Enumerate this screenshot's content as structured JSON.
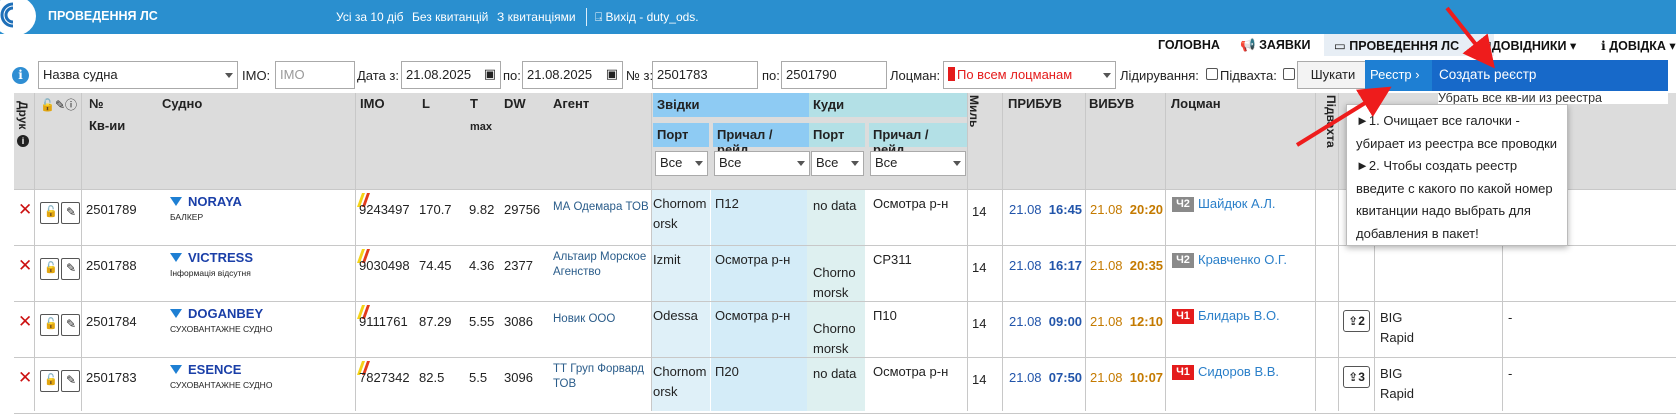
{
  "topbar": {
    "app_title": "ПРОВЕДЕННЯ ЛС",
    "links": [
      "Усі за 10 діб",
      "Без квитанцій",
      "З квитанціями"
    ],
    "exit_label": "Вихід - duty_ods."
  },
  "nav": {
    "home": "ГОЛОВНА",
    "requests": "ЗАЯВКИ",
    "pilotage": "ПРОВЕДЕННЯ ЛС",
    "references": "ДОВІДНИКИ",
    "help": "ДОВІДКА"
  },
  "filters": {
    "ship_select": "Назва судна",
    "imo_label": "IMO:",
    "imo_placeholder": "IMO",
    "date_from_label": "Дата з:",
    "date_from": "21.08.2025",
    "date_to_label": "по:",
    "date_to": "21.08.2025",
    "num_from_label": "№ з:",
    "num_from": "2501783",
    "num_to_label": "по:",
    "num_to": "2501790",
    "pilot_label": "Лоцман:",
    "pilot_select": "По всем лоцманам",
    "leading_label": "Лідирування:",
    "towage_label": "Підвахта:",
    "search_button": "Шукати",
    "registry_button": "Реєстр ›",
    "create_registry": "Создать реєстр",
    "remove_all_hint": "Убрать все кв-ии из реестра"
  },
  "popup": {
    "line1": "►1. Очищает все галочки - убирает из реестра все проводки",
    "line2": "►2. Чтобы создать реестр введите с какого по какой номер квитанции надо выбрать для добавления в пакет!"
  },
  "headers": {
    "print": "Друк",
    "num": "№",
    "num2": "Кв-ии",
    "ship": "Судно",
    "imo": "IMO",
    "l": "L",
    "t": "T",
    "tmax": "max",
    "dw": "DW",
    "agent": "Агент",
    "from": "Звідки",
    "to": "Куди",
    "port": "Порт",
    "berth": "Причал / рейд",
    "miles": "Миль",
    "arrival": "ПРИБУВ",
    "departure": "ВИБУВ",
    "pilot": "Лоцман",
    "towage": "Підвахта",
    "filter_all": "Все"
  },
  "rows": [
    {
      "num": "2501789",
      "ship": "NORAYA",
      "type": "БАЛКЕР",
      "imo": "9243497",
      "l": "170.7",
      "t": "9.82",
      "dw": "29756",
      "agent": "МА Одемара ТОВ",
      "from_port": "Chornomorsk",
      "from_berth": "П12",
      "to_port": "no data",
      "to_berth": "Осмотра р-н",
      "miles": "14",
      "arr_date": "21.08",
      "arr_time": "16:45",
      "dep_date": "21.08",
      "dep_time": "20:20",
      "pilot_class": "Ч2",
      "pilot_color": "#8a8a8a",
      "pilot": "Шайдюк А.Л.",
      "boats": "",
      "tow": "",
      "extra": ""
    },
    {
      "num": "2501788",
      "ship": "VICTRESS",
      "type": "Інформація відсутня",
      "imo": "9030498",
      "l": "74.45",
      "t": "4.36",
      "dw": "2377",
      "agent": "Альтаир Морское Агенство",
      "from_port": "Izmit",
      "from_berth": "Осмотра р-н",
      "to_port": "Chornomorsk",
      "to_berth": "СР311",
      "miles": "14",
      "arr_date": "21.08",
      "arr_time": "16:17",
      "dep_date": "21.08",
      "dep_time": "20:35",
      "pilot_class": "Ч2",
      "pilot_color": "#8a8a8a",
      "pilot": "Кравченко О.Г.",
      "boats": "",
      "tow": "",
      "extra": ""
    },
    {
      "num": "2501784",
      "ship": "DOGANBEY",
      "type": "СУХОВАНТАЖНЕ СУДНО",
      "imo": "9111761",
      "l": "87.29",
      "t": "5.55",
      "dw": "3086",
      "agent": "Новик ООО",
      "from_port": "Odessa",
      "from_berth": "Осмотра р-н",
      "to_port": "Chornomorsk",
      "to_berth": "П10",
      "miles": "14",
      "arr_date": "21.08",
      "arr_time": "09:00",
      "dep_date": "21.08",
      "dep_time": "12:10",
      "pilot_class": "Ч1",
      "pilot_color": "#e41b1b",
      "pilot": "Блидарь В.О.",
      "boats": "2",
      "tow": "BIG Rapid",
      "extra": "-"
    },
    {
      "num": "2501783",
      "ship": "ESENCE",
      "type": "СУХОВАНТАЖНЕ СУДНО",
      "imo": "7827342",
      "l": "82.5",
      "t": "5.5",
      "dw": "3096",
      "agent": "ТТ Груп Форвард ТОВ",
      "from_port": "Chornomorsk",
      "from_berth": "П20",
      "to_port": "no data",
      "to_berth": "Осмотра р-н",
      "miles": "14",
      "arr_date": "21.08",
      "arr_time": "07:50",
      "dep_date": "21.08",
      "dep_time": "10:07",
      "pilot_class": "Ч1",
      "pilot_color": "#e41b1b",
      "pilot": "Сидоров В.В.",
      "boats": "3",
      "tow": "BIG Rapid",
      "extra": "-"
    }
  ],
  "colors": {
    "accent": "#2a8fcf",
    "arrow": "#ee1c1c"
  }
}
